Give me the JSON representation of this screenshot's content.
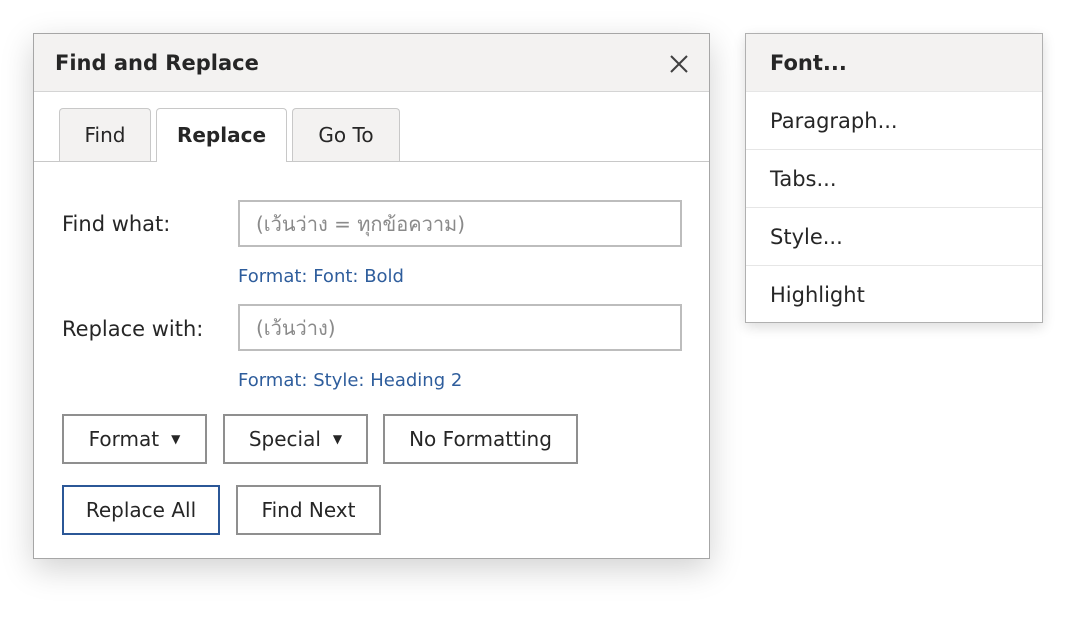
{
  "dialog": {
    "title": "Find and Replace",
    "tabs": [
      {
        "label": "Find",
        "active": false
      },
      {
        "label": "Replace",
        "active": true
      },
      {
        "label": "Go To",
        "active": false
      }
    ],
    "find": {
      "label": "Find what:",
      "value": "",
      "placeholder": "(เว้นว่าง = ทุกข้อความ)",
      "format_note": "Format:  Font: Bold"
    },
    "replace": {
      "label": "Replace with:",
      "value": "",
      "placeholder": "(เว้นว่าง)",
      "format_note": "Format:  Style: Heading 2"
    },
    "buttons": {
      "format": "Format",
      "special": "Special",
      "no_formatting": "No Formatting",
      "replace_all": "Replace All",
      "find_next": "Find Next"
    }
  },
  "format_menu": {
    "items": [
      {
        "label": "Font...",
        "selected": true
      },
      {
        "label": "Paragraph...",
        "selected": false
      },
      {
        "label": "Tabs...",
        "selected": false
      },
      {
        "label": "Style...",
        "selected": false
      },
      {
        "label": "Highlight",
        "selected": false
      }
    ]
  },
  "icons": {
    "close": "close-icon",
    "dropdown": "caret-down-icon"
  },
  "colors": {
    "accent_border": "#2b5797",
    "format_note_text": "#2e5d9c",
    "titlebar_bg": "#f3f2f1"
  }
}
